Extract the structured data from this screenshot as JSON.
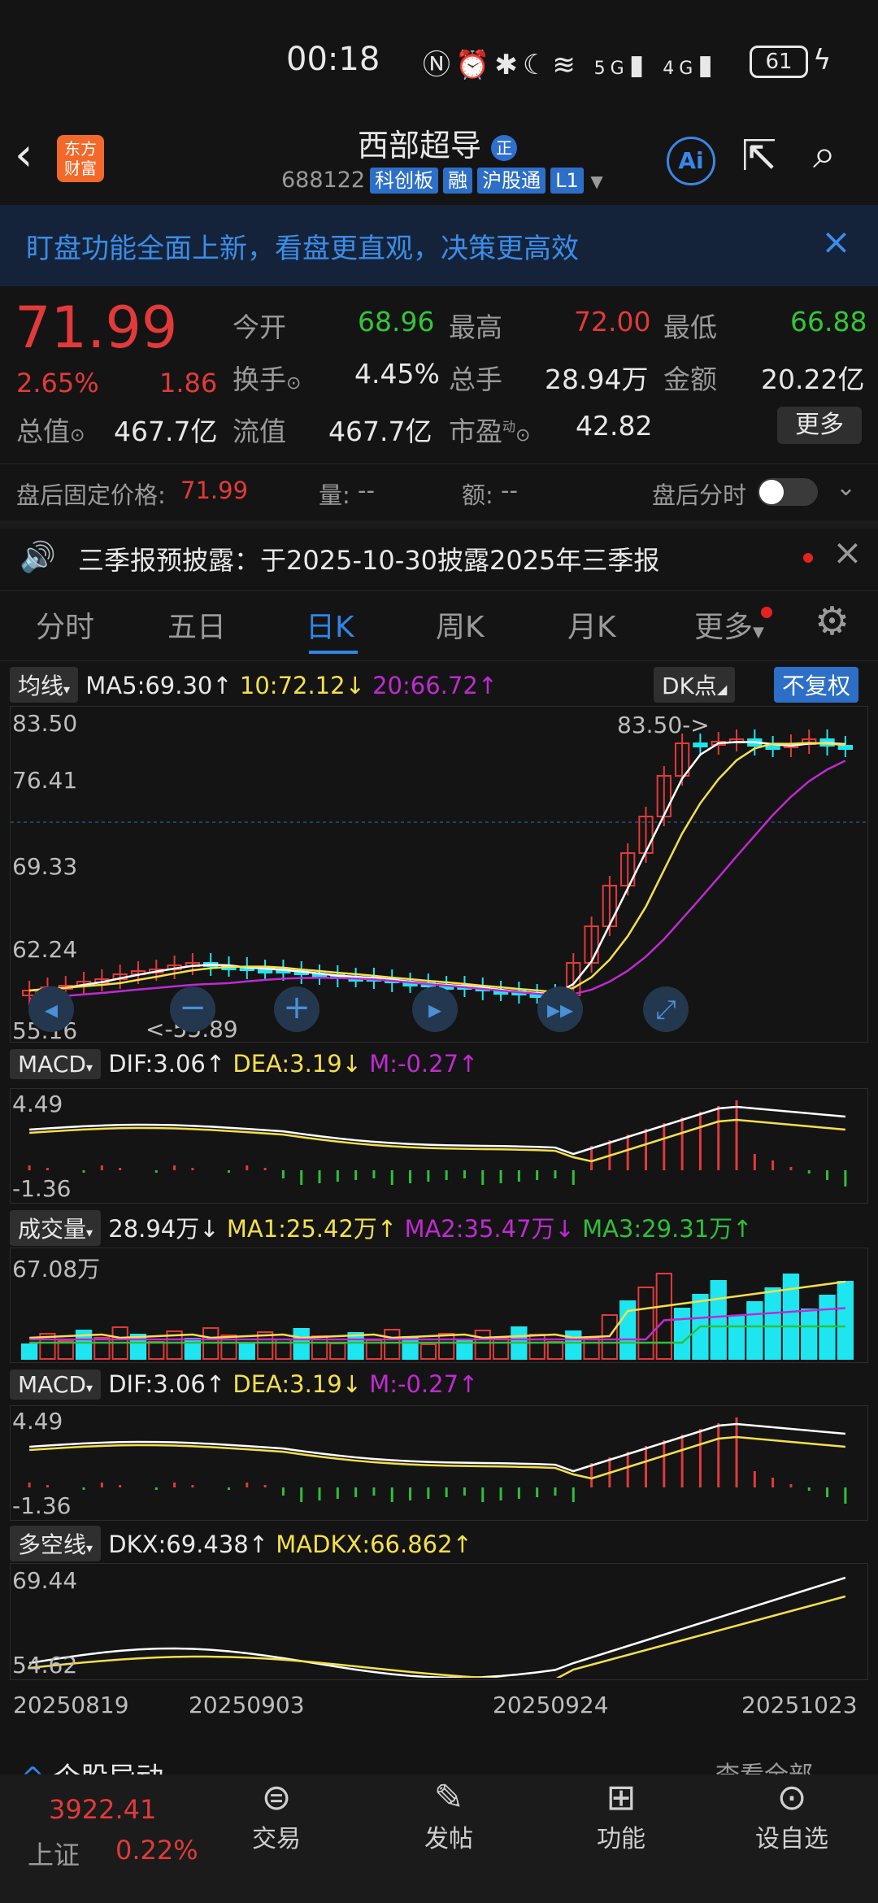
{
  "status_bar": {
    "time": "00:18",
    "net1": "5G",
    "net2": "4G",
    "battery": "61"
  },
  "header": {
    "logo_line1": "东方",
    "logo_line2": "财富",
    "stock_name": "西部超导",
    "badge": "正",
    "code": "688122",
    "chips": [
      "科创板",
      "融",
      "沪股通",
      "L1"
    ],
    "ai_label": "Ai"
  },
  "banner": {
    "text": "盯盘功能全面上新，看盘更直观，决策更高效"
  },
  "quote": {
    "price": "71.99",
    "pct": "2.65%",
    "change": "1.86",
    "rows": [
      [
        {
          "label": "今开",
          "value": "68.96",
          "color": "green"
        },
        {
          "label": "最高",
          "value": "72.00",
          "color": "red"
        },
        {
          "label": "最低",
          "value": "66.88",
          "color": "green"
        }
      ],
      [
        {
          "label": "换手",
          "value": "4.45%",
          "color": "white"
        },
        {
          "label": "总手",
          "value": "28.94万",
          "color": "white"
        },
        {
          "label": "金额",
          "value": "20.22亿",
          "color": "white"
        }
      ]
    ],
    "total_cap_label": "总值",
    "total_cap": "467.7亿",
    "float_cap_label": "流值",
    "float_cap": "467.7亿",
    "pe_label": "市盈",
    "pe_sup": "动",
    "pe": "42.82",
    "more": "更多"
  },
  "after_hours": {
    "label": "盘后固定价格:",
    "price": "71.99",
    "vol_label": "量:",
    "vol": "--",
    "amt_label": "额:",
    "amt": "--",
    "fenshi": "盘后分时"
  },
  "notice": {
    "text": "三季报预披露：于2025-10-30披露2025年三季报"
  },
  "tabs": [
    "分时",
    "五日",
    "日K",
    "周K",
    "月K",
    "更多"
  ],
  "kline": {
    "ma_label": "均线",
    "ma5": "MA5:69.30↑",
    "ma10": "10:72.12↓",
    "ma20": "20:66.72↑",
    "dk_label": "DK点",
    "fq_label": "不复权",
    "y_labels": [
      "83.50",
      "76.41",
      "69.33",
      "62.24",
      "55.16"
    ],
    "max_note": "83.50->",
    "min_note": "<-55.89"
  },
  "macd1": {
    "label": "MACD",
    "dif": "DIF:3.06↑",
    "dea": "DEA:3.19↓",
    "m": "M:-0.27↑",
    "y_top": "4.49",
    "y_bottom": "-1.36"
  },
  "volume": {
    "label": "成交量",
    "vol": "28.94万↓",
    "ma1": "MA1:25.42万↑",
    "ma2": "MA2:35.47万↓",
    "ma3": "MA3:29.31万↑",
    "y_top": "67.08万"
  },
  "macd2": {
    "label": "MACD",
    "dif": "DIF:3.06↑",
    "dea": "DEA:3.19↓",
    "m": "M:-0.27↑",
    "y_top": "4.49",
    "y_bottom": "-1.36"
  },
  "dkx": {
    "label": "多空线",
    "dkx": "DKX:69.438↑",
    "madkx": "MADKX:66.862↑",
    "y_top": "69.44",
    "y_bottom": "54.62"
  },
  "x_dates": [
    "20250819",
    "20250903",
    "20250924",
    "20251023"
  ],
  "section_peek": {
    "title": "个股异动",
    "link": "查看全部"
  },
  "bottom_nav": {
    "index_value": "3922.41",
    "index_name": "上证",
    "index_pct": "0.22%",
    "items": [
      "交易",
      "发帖",
      "功能",
      "设自选"
    ]
  },
  "colors": {
    "up": "#e23a3a",
    "down": "#1ee6f0",
    "ma5": "#ffffff",
    "ma10": "#f4e04a",
    "ma20": "#c02ad1",
    "accent": "#2f86e8"
  }
}
